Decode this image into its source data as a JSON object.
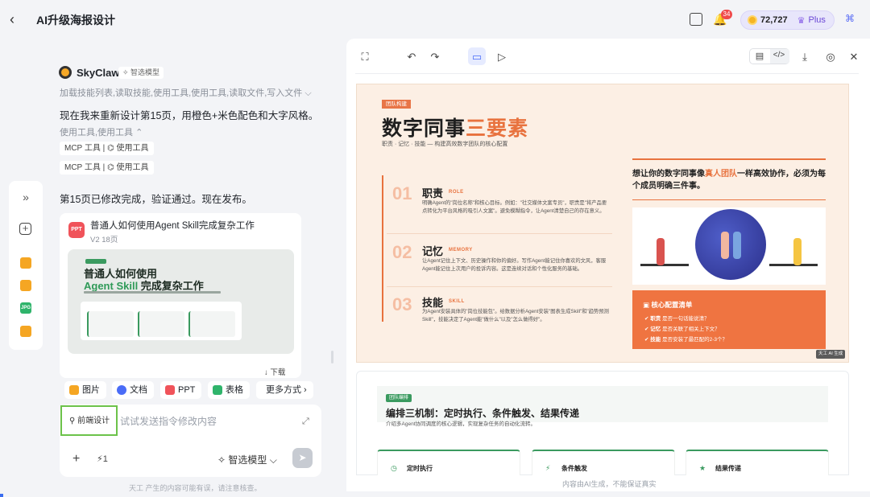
{
  "header": {
    "back_glyph": "‹",
    "title": "AI升级海报设计",
    "notification_count": "34",
    "credits": "72,727",
    "plan": "Plus"
  },
  "chat": {
    "bot_name": "SkyClaw",
    "model_tag": "智选模型",
    "tool_summary_1": "加载技能列表,读取技能,使用工具,使用工具,读取文件,写入文件 ⌵",
    "message_1": "现在我来重新设计第15页，用橙色+米色配色和大字风格。",
    "tool_summary_2": "使用工具,使用工具 ⌃",
    "chips": [
      {
        "tool": "MCP 工具",
        "action": "使用工具"
      },
      {
        "tool": "MCP 工具",
        "action": "使用工具"
      }
    ],
    "message_2": "第15页已修改完成，验证通过。现在发布。",
    "card": {
      "badge": "PPT",
      "title": "普通人如何使用Agent Skill完成复杂工作",
      "meta": "V2   18页",
      "thumb_line1": "普通人如何使用",
      "thumb_line2_accent": "Agent Skill",
      "thumb_line2_rest": " 完成复杂工作",
      "download": "↓ 下载"
    }
  },
  "composer": {
    "attach_buttons": [
      {
        "label": "图片",
        "color": "#f5a623"
      },
      {
        "label": "文档",
        "color": "#4a6cf7"
      },
      {
        "label": "PPT",
        "color": "#f0535a"
      },
      {
        "label": "表格",
        "color": "#2fb46b"
      },
      {
        "label": "更多方式 ›",
        "color": ""
      }
    ],
    "mode": "前端设计",
    "placeholder": "试试发送指令修改内容",
    "count": "1",
    "model": "智选模型 ⌵",
    "disclaimer": "天工 产生的内容可能有误，请注意核查。"
  },
  "preview": {
    "footer": "内容由AI生成，不能保证真实",
    "slide15": {
      "tag": "团队构建",
      "title_plain": "数字同事",
      "title_accent": "三要素",
      "subtitle": "职责 · 记忆 · 技能 — 构建高效数字团队的核心配置",
      "items": [
        {
          "num": "01",
          "head": "职责",
          "en": "ROLE",
          "desc": "明确Agent的\"岗位名称\"和核心目标。例如：\"社交媒体文案专员\"，职责是\"将产品要点转化为平台风格的吸引人文案\"。避免模糊指令，让Agent清楚自己的存在意义。"
        },
        {
          "num": "02",
          "head": "记忆",
          "en": "MEMORY",
          "desc": "让Agent记住上下文、历史操作和你的偏好。写作Agent能记住你喜欢的文风，客服Agent能记住上次用户的投诉内容。这是连续对话和个性化服务的基础。"
        },
        {
          "num": "03",
          "head": "技能",
          "en": "SKILL",
          "desc": "为Agent安装具体的\"岗位技能包\"。给数据分析Agent安装\"图表生成Skill\"和\"趋势预测Skill\"，技能决定了Agent能\"做什么\"以及\"怎么做得好\"。"
        }
      ],
      "right_head_1": "想让你的数字同事像",
      "right_head_accent": "真人团队",
      "right_head_2": "一样高效协作，必须为每个成员明确三件事。",
      "checklist_title": "核心配置清单",
      "checklist": [
        {
          "key": "职责",
          "text": "是否一句话能说清？"
        },
        {
          "key": "记忆",
          "text": "是否关联了相关上下文？"
        },
        {
          "key": "技能",
          "text": "是否安装了最匹配的2-3个？"
        }
      ],
      "watermark": "天工 AI 生成"
    },
    "slide16": {
      "tag": "团队编排",
      "title": "编排三机制：定时执行、条件触发、结果传递",
      "subtitle": "介绍多Agent协同调度的核心逻辑，实现复杂任务的自动化流转。",
      "cards": [
        "定时执行",
        "条件触发",
        "结果传递"
      ]
    }
  }
}
